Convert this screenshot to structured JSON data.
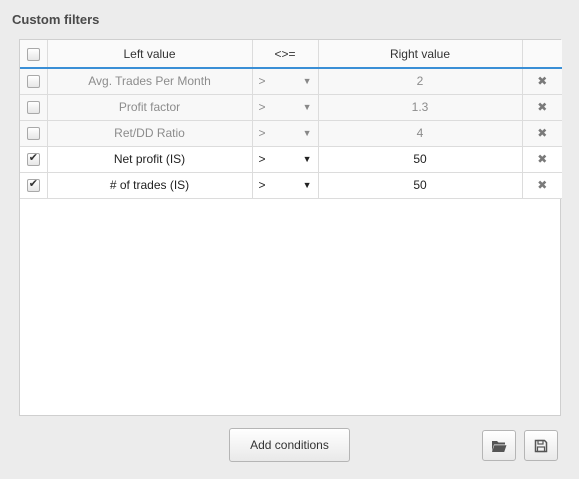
{
  "title": "Custom filters",
  "table": {
    "headers": {
      "select_all": "",
      "left": "Left value",
      "op": "<>=",
      "right": "Right value",
      "remove": ""
    },
    "rows": [
      {
        "checked": false,
        "left": "Avg. Trades Per Month",
        "op": ">",
        "right": "2"
      },
      {
        "checked": false,
        "left": "Profit factor",
        "op": ">",
        "right": "1.3"
      },
      {
        "checked": false,
        "left": "Ret/DD Ratio",
        "op": ">",
        "right": "4"
      },
      {
        "checked": true,
        "left": "Net profit (IS)",
        "op": ">",
        "right": "50"
      },
      {
        "checked": true,
        "left": "# of trades (IS)",
        "op": ">",
        "right": "50"
      }
    ],
    "dropdown_icon": "triangle-down",
    "remove_icon": "x-mark"
  },
  "buttons": {
    "add_conditions": "Add conditions",
    "open_icon": "folder-open",
    "save_icon": "floppy-disk"
  }
}
